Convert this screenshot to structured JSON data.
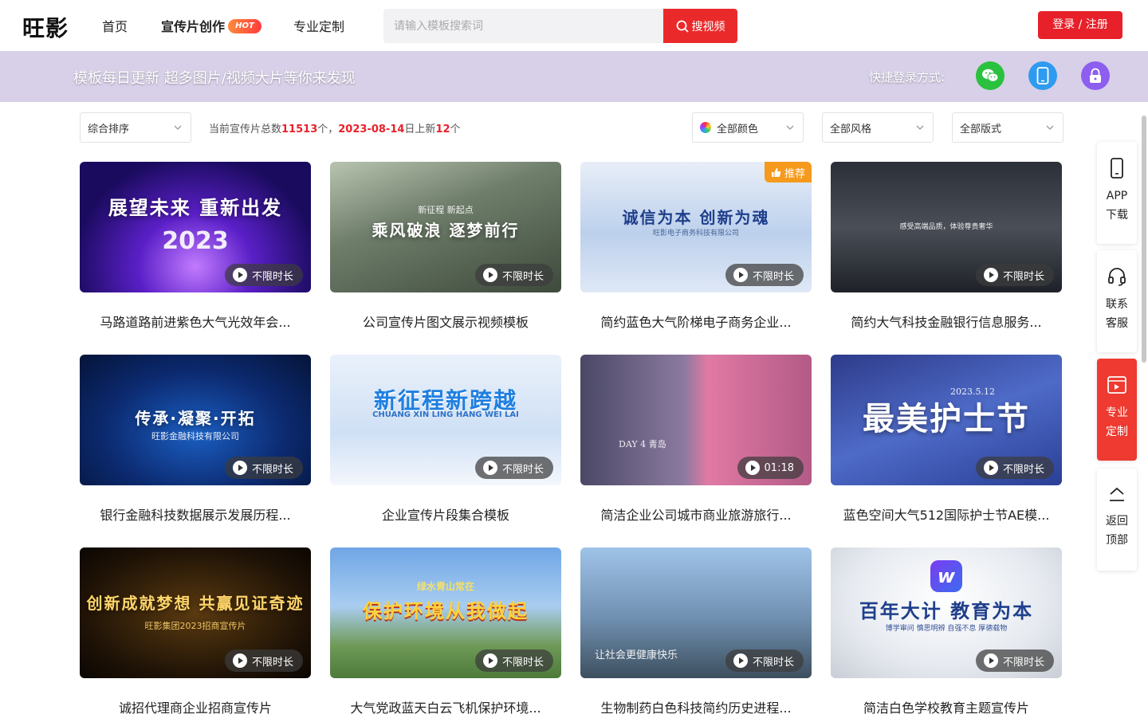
{
  "header": {
    "logo": "旺影",
    "nav": {
      "home": "首页",
      "create": "宣传片创作",
      "create_badge": "HOT",
      "custom": "专业定制"
    },
    "search": {
      "placeholder": "请输入模板搜索词",
      "button": "搜视频"
    },
    "login": "登录 / 注册"
  },
  "banner": {
    "text": "模板每日更新 超多图片/视频大片等你来发现",
    "quick_login_label": "快捷登录方式:",
    "quick_icons": [
      "wechat-icon",
      "phone-icon",
      "lock-icon"
    ]
  },
  "filters": {
    "sort": "综合排序",
    "stats": {
      "prefix": "当前宣传片总数",
      "total": "11513",
      "mid": "个，",
      "date": "2023-08-14",
      "new_prefix": "日上新",
      "new_count": "12",
      "suffix": "个"
    },
    "color": "全部颜色",
    "style": "全部风格",
    "format": "全部版式"
  },
  "cards": [
    {
      "title": "马路道路前进紫色大气光效年会...",
      "thumb_title": "展望未来 重新出发",
      "thumb_sub": "2023",
      "duration": "不限时长"
    },
    {
      "title": "公司宣传片图文展示视频模板",
      "thumb_title": "乘风破浪 逐梦前行",
      "thumb_sub": "新征程 新起点",
      "duration": "不限时长"
    },
    {
      "title": "简约蓝色大气阶梯电子商务企业...",
      "thumb_title": "诚信为本 创新为魂",
      "thumb_sub": "旺影电子商务科技有限公司",
      "duration": "不限时长",
      "badge": "推荐"
    },
    {
      "title": "简约大气科技金融银行信息服务...",
      "thumb_title": "",
      "thumb_sub": "感受高端品质，体验尊贵奢华",
      "duration": "不限时长"
    },
    {
      "title": "银行金融科技数据展示发展历程...",
      "thumb_title": "传承·凝聚·开拓",
      "thumb_sub": "旺影金融科技有限公司",
      "duration": "不限时长"
    },
    {
      "title": "企业宣传片段集合模板",
      "thumb_title": "新征程新跨越",
      "thumb_sub": "CHUANG XIN LING HANG WEI LAI",
      "duration": "不限时长"
    },
    {
      "title": "简洁企业公司城市商业旅游旅行...",
      "thumb_title": "",
      "thumb_sub": "DAY 4 青岛",
      "duration": "01:18"
    },
    {
      "title": "蓝色空间大气512国际护士节AE模...",
      "thumb_title": "最美护士节",
      "thumb_sub": "2023.5.12",
      "duration": "不限时长"
    },
    {
      "title": "诚招代理商企业招商宣传片",
      "thumb_title": "创新成就梦想 共赢见证奇迹",
      "thumb_sub": "旺影集团2023招商宣传片",
      "duration": "不限时长"
    },
    {
      "title": "大气党政蓝天白云飞机保护环境...",
      "thumb_title": "保护环境从我做起",
      "thumb_sub": "绿水青山常在",
      "duration": "不限时长"
    },
    {
      "title": "生物制药白色科技简约历史进程...",
      "thumb_title": "",
      "thumb_sub": "让社会更健康快乐",
      "duration": "不限时长"
    },
    {
      "title": "简洁白色学校教育主题宣传片",
      "thumb_title": "百年大计 教育为本",
      "thumb_sub": "博学审问 慎思明辨 自强不息 厚德载物",
      "duration": "不限时长"
    }
  ],
  "float_bar": {
    "app": [
      "APP",
      "下载"
    ],
    "service": [
      "联系",
      "客服"
    ],
    "custom": [
      "专业",
      "定制"
    ],
    "top": [
      "返回",
      "顶部"
    ]
  },
  "colors": {
    "accent": "#e8202a",
    "banner": "#d8d0e8",
    "badge": "#f59a1c"
  }
}
